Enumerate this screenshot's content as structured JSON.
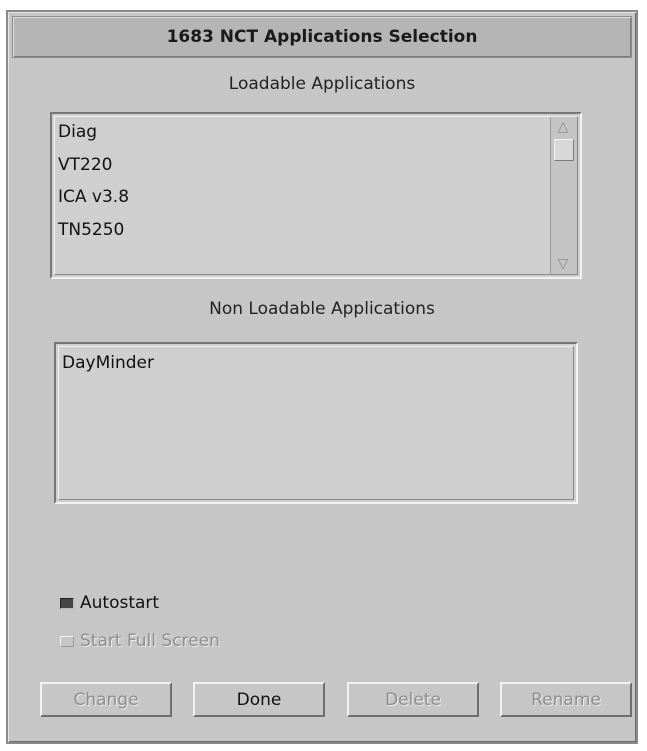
{
  "window": {
    "title": "1683 NCT Applications Selection"
  },
  "loadable": {
    "label": "Loadable Applications",
    "items": [
      "Diag",
      "VT220",
      "ICA v3.8",
      "TN5250"
    ]
  },
  "non_loadable": {
    "label": "Non Loadable Applications",
    "items": [
      "DayMinder"
    ]
  },
  "options": {
    "autostart": {
      "label": "Autostart",
      "checked": true
    },
    "full_screen": {
      "label": "Start Full Screen",
      "checked": false,
      "enabled": false
    }
  },
  "buttons": {
    "change": "Change",
    "done": "Done",
    "delete": "Delete",
    "rename": "Rename"
  },
  "icons": {
    "scroll_up": "scroll-up-arrow-icon",
    "scroll_down": "scroll-down-arrow-icon"
  }
}
